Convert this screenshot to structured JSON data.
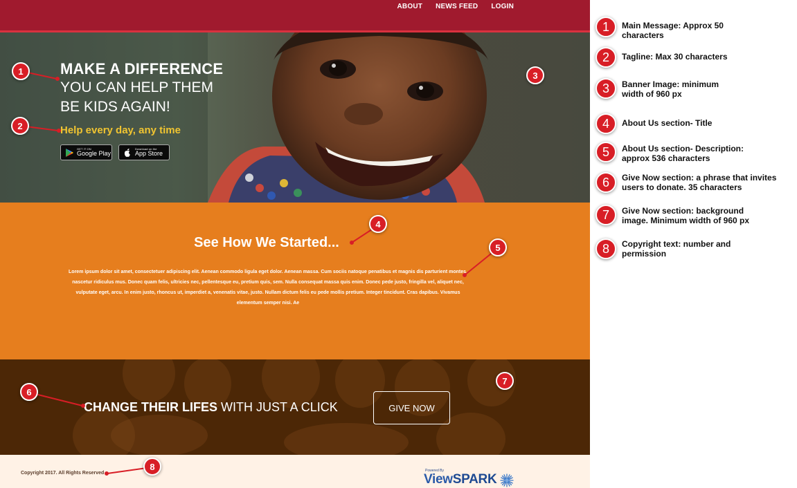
{
  "nav": {
    "links": [
      "ABOUT",
      "NEWS FEED",
      "LOGIN"
    ]
  },
  "hero": {
    "headline": "MAKE A DIFFERENCE",
    "sub_line1": "YOU CAN HELP THEM",
    "sub_line2": "BE KIDS AGAIN!",
    "tagline": "Help every day, any time",
    "google_play": {
      "small": "GET IT ON",
      "big": "Google Play",
      "icon": "google-play-icon"
    },
    "app_store": {
      "small": "Download on the",
      "big": "App Store",
      "icon": "apple-icon"
    }
  },
  "about": {
    "title": "See How We Started...",
    "description": "Lorem ipsum dolor sit amet, consectetuer adipiscing elit. Aenean commodo ligula eget dolor. Aenean massa. Cum sociis natoque penatibus et magnis dis parturient montes, nascetur ridiculus mus. Donec quam felis, ultricies nec, pellentesque eu, pretium quis, sem. Nulla consequat massa quis enim. Donec pede justo, fringilla vel, aliquet nec, vulputate eget, arcu. In enim justo, rhoncus ut, imperdiet a, venenatis vitae, justo. Nullam dictum felis eu pede mollis pretium. Integer tincidunt. Cras dapibus. Vivamus elementum semper nisi. Ae"
  },
  "give": {
    "bold_text": "CHANGE THEIR LIFES",
    "light_text": " WITH JUST A CLICK",
    "button": "GIVE NOW"
  },
  "footer": {
    "copyright": "Copyright 2017. All Rights Reserved",
    "powered_by": "Powered By",
    "brand_view": "View",
    "brand_spark": "SPARK"
  },
  "markers": [
    "1",
    "2",
    "3",
    "4",
    "5",
    "6",
    "7",
    "8"
  ],
  "legend": [
    {
      "number": "1",
      "text": "Main Message: Approx 50 characters"
    },
    {
      "number": "2",
      "text": "Tagline: Max 30 characters"
    },
    {
      "number": "3",
      "text": "Banner Image: minimum width of 960 px"
    },
    {
      "number": "4",
      "text": "About Us section- Title"
    },
    {
      "number": "5",
      "text": "About Us section- Description: approx 536 characters"
    },
    {
      "number": "6",
      "text": "Give Now section: a phrase that invites users to donate. 35 characters"
    },
    {
      "number": "7",
      "text": "Give Now section: background image. Minimum width of 960 px"
    },
    {
      "number": "8",
      "text": "Copyright text: number and permission"
    }
  ],
  "colors": {
    "nav_bg": "#a01a2e",
    "tagline": "#f0c431",
    "about_bg": "#e67e1e",
    "give_bg": "#4f2a08",
    "footer_bg": "#fff2e6",
    "marker": "#d81e26"
  }
}
